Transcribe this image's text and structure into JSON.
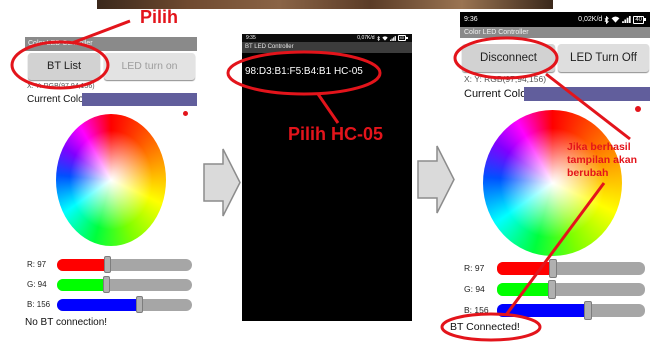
{
  "annotations": {
    "color": "#E3141B",
    "step1_label": "Pilih",
    "step2_label": "Pilih HC-05",
    "step3_lines": [
      "Jika berhasil",
      "tampilan akan",
      "berubah"
    ]
  },
  "screen_before": {
    "title": "Color LED Controller",
    "bt_list_button": "BT List",
    "led_button": "LED turn on",
    "coords_text": "X: Y: RGB(97,94,156)",
    "current_color_label": "Current Color:",
    "current_color": "#615E9C",
    "sliders": [
      {
        "label": "R: 97",
        "value": 97,
        "color": "#FF0000"
      },
      {
        "label": "G: 94",
        "value": 94,
        "color": "#00FF00"
      },
      {
        "label": "B: 156",
        "value": 156,
        "color": "#0000FF"
      }
    ],
    "status": "No BT connection!"
  },
  "device_list_screen": {
    "status_bar": {
      "time": "9:35",
      "speed": "0,07K/d",
      "battery": "40",
      "icons": [
        "bluetooth-icon",
        "wifi-icon",
        "signal-icon",
        "battery-icon"
      ]
    },
    "title": "BT LED Controller",
    "devices": [
      "98:D3:B1:F5:B4:B1 HC-05"
    ]
  },
  "screen_after": {
    "status_bar": {
      "time": "9:36",
      "speed": "0,02K/d",
      "battery": "40",
      "icons": [
        "bluetooth-icon",
        "wifi-icon",
        "signal-icon",
        "battery-icon"
      ]
    },
    "title": "Color LED Controller",
    "disconnect_button": "Disconnect",
    "led_button": "LED Turn Off",
    "coords_text": "X: Y: RGB(97,94,156)",
    "current_color_label": "Current Color:",
    "current_color": "#615E9C",
    "sliders": [
      {
        "label": "R: 97",
        "value": 97,
        "color": "#FF0000"
      },
      {
        "label": "G: 94",
        "value": 94,
        "color": "#00FF00"
      },
      {
        "label": "B: 156",
        "value": 156,
        "color": "#0000FF"
      }
    ],
    "status": "BT Connected!"
  }
}
